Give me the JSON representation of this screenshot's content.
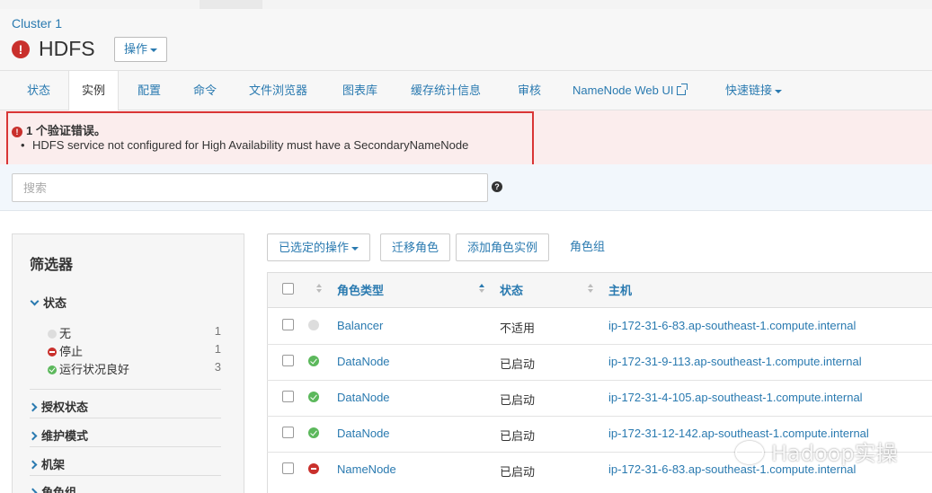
{
  "header": {
    "cluster_link": "Cluster 1",
    "service_name": "HDFS",
    "actions_label": "操作"
  },
  "tabs": [
    {
      "label": "状态"
    },
    {
      "label": "实例",
      "active": true
    },
    {
      "label": "配置"
    },
    {
      "label": "命令"
    },
    {
      "label": "文件浏览器"
    },
    {
      "label": "图表库"
    },
    {
      "label": "缓存统计信息"
    },
    {
      "label": "审核"
    },
    {
      "label": "NameNode Web UI"
    },
    {
      "label": "快速链接"
    }
  ],
  "alert": {
    "title": "1 个验证错误。",
    "items": [
      "HDFS service not configured for High Availability must have a SecondaryNameNode"
    ]
  },
  "search": {
    "placeholder": "搜索"
  },
  "filters": {
    "heading": "筛选器",
    "status_section": "状态",
    "status_options": [
      {
        "label": "无",
        "count": "1",
        "icon": "gray-dot-icon"
      },
      {
        "label": "停止",
        "count": "1",
        "icon": "stopped-icon"
      },
      {
        "label": "运行状况良好",
        "count": "3",
        "icon": "healthy-icon"
      }
    ],
    "collapsed_sections": [
      "授权状态",
      "维护模式",
      "机架",
      "角色组"
    ]
  },
  "toolbar": {
    "selected_actions": "已选定的操作",
    "migrate_roles": "迁移角色",
    "add_role_instances": "添加角色实例",
    "role_groups": "角色组"
  },
  "table": {
    "headers": {
      "role_type": "角色类型",
      "status": "状态",
      "host": "主机"
    },
    "rows": [
      {
        "status_icon": "gray",
        "role_type": "Balancer",
        "status": "不适用",
        "host": "ip-172-31-6-83.ap-southeast-1.compute.internal"
      },
      {
        "status_icon": "green",
        "role_type": "DataNode",
        "status": "已启动",
        "host": "ip-172-31-9-113.ap-southeast-1.compute.internal"
      },
      {
        "status_icon": "green",
        "role_type": "DataNode",
        "status": "已启动",
        "host": "ip-172-31-4-105.ap-southeast-1.compute.internal"
      },
      {
        "status_icon": "green",
        "role_type": "DataNode",
        "status": "已启动",
        "host": "ip-172-31-12-142.ap-southeast-1.compute.internal"
      },
      {
        "status_icon": "red",
        "role_type": "NameNode",
        "status": "已启动",
        "host": "ip-172-31-6-83.ap-southeast-1.compute.internal"
      }
    ]
  },
  "watermark": "Hadoop实操",
  "colors": {
    "link": "#2a7ab0",
    "error": "#c9302c",
    "ok": "#5cb85c",
    "highlight_border": "#d93535"
  }
}
